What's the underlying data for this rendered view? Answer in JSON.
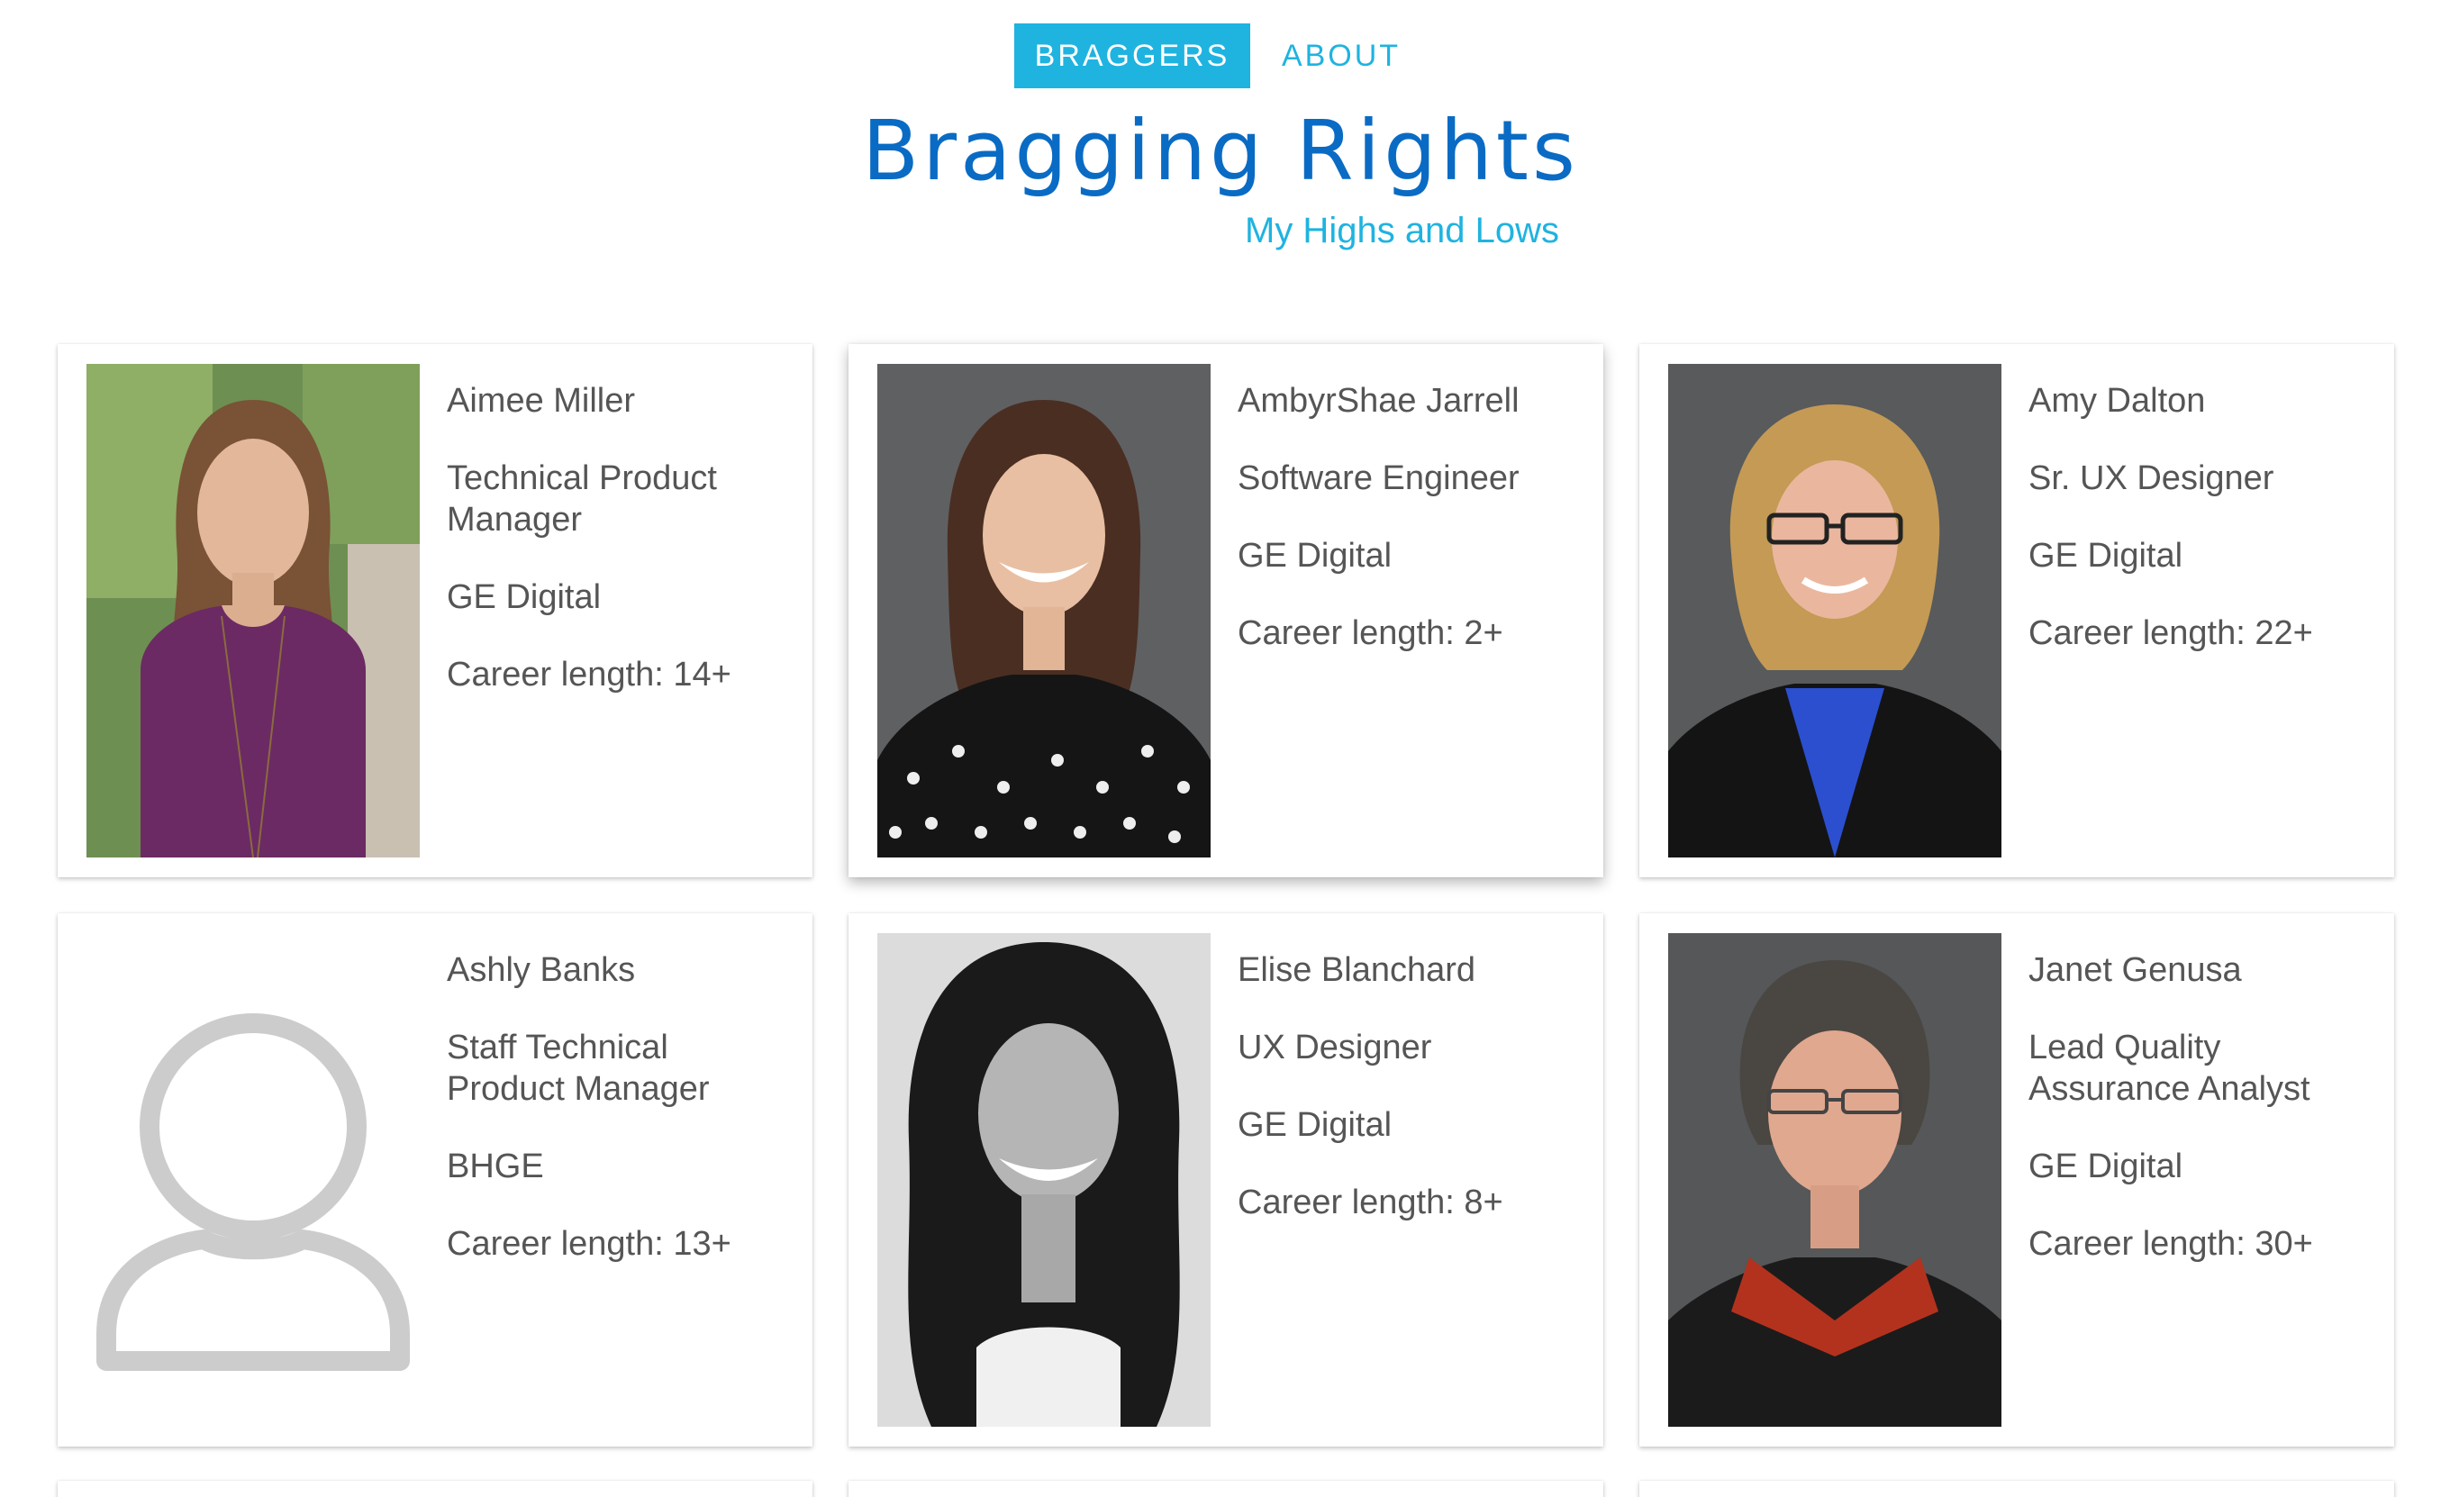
{
  "nav": {
    "items": [
      {
        "label": "BRAGGERS",
        "active": true
      },
      {
        "label": "ABOUT",
        "active": false
      }
    ]
  },
  "header": {
    "title": "Bragging Rights",
    "subtitle": "My Highs and Lows"
  },
  "colors": {
    "accent": "#1fb3e0",
    "title": "#0a6bc4",
    "text": "#555555"
  },
  "braggers": [
    {
      "name": "Aimee Miller",
      "title": "Technical Product Manager",
      "company": "GE Digital",
      "career": "Career length: 14+",
      "photo": "photo-aimee"
    },
    {
      "name": "AmbyrShae Jarrell",
      "title": "Software Engineer",
      "company": "GE Digital",
      "career": "Career length: 2+",
      "photo": "photo-ambyrshae"
    },
    {
      "name": "Amy Dalton",
      "title": "Sr. UX Designer",
      "company": "GE Digital",
      "career": "Career length: 22+",
      "photo": "photo-amy"
    },
    {
      "name": "Ashly Banks",
      "title": "Staff Technical Product Manager",
      "company": "BHGE",
      "career": "Career length: 13+",
      "photo": "avatar-placeholder-icon"
    },
    {
      "name": "Elise Blanchard",
      "title": "UX Designer",
      "company": "GE Digital",
      "career": "Career length: 8+",
      "photo": "photo-elise"
    },
    {
      "name": "Janet Genusa",
      "title": "Lead Quality Assurance Analyst",
      "company": "GE Digital",
      "career": "Career length: 30+",
      "photo": "photo-janet"
    }
  ]
}
